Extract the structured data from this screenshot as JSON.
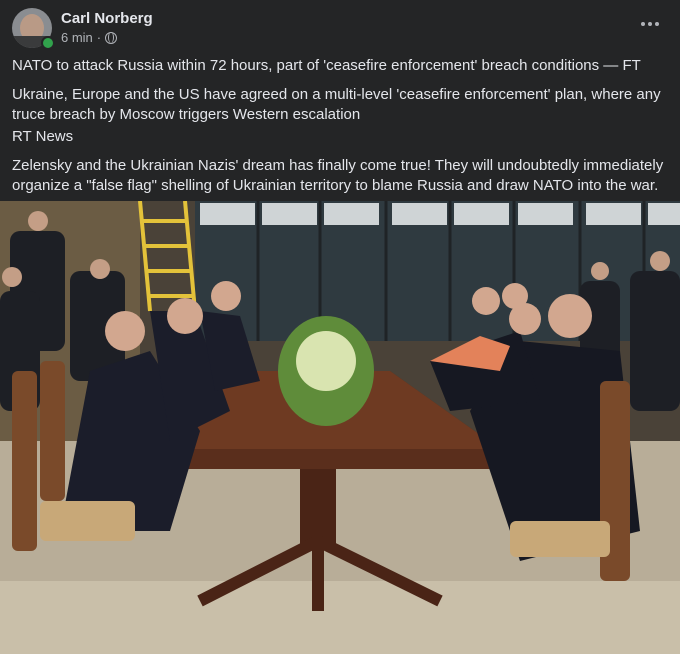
{
  "post": {
    "author": "Carl Norberg",
    "time": "6 min",
    "separator": "·",
    "privacy_icon": "globe-icon",
    "more_icon": "more-horizontal-icon",
    "paragraphs": [
      "NATO to attack Russia within 72 hours, part of 'ceasefire enforcement' breach conditions — FT",
      "Ukraine, Europe and the US have agreed on a multi-level 'ceasefire enforcement' plan, where any truce breach by Moscow triggers Western escalation",
      "RT News",
      "Zelensky and the Ukrainian Nazis' dream has finally come true! They will undoubtedly immediately organize a \"false flag\" shelling of Ukrainian territory to blame Russia and draw NATO into the war."
    ]
  },
  "colors": {
    "background": "#242526",
    "text_primary": "#e4e6eb",
    "text_secondary": "#b0b3b8",
    "online": "#31a24c"
  }
}
